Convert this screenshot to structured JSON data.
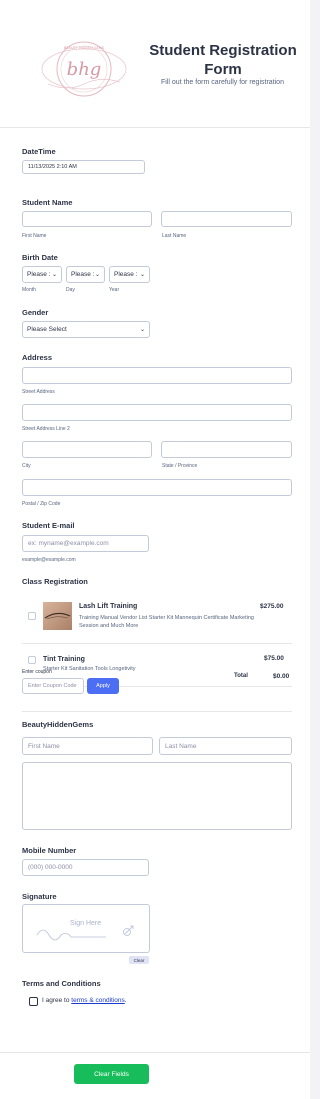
{
  "header": {
    "logo_text": "bhg",
    "logo_ring_text": "BEAUTY HIDDEN GEMS",
    "title": "Student Registration Form",
    "subtitle": "Fill out the form carefully for registration"
  },
  "datetime": {
    "label": "DateTime",
    "value": "11/13/2025 2:10 AM"
  },
  "student_name": {
    "label": "Student Name",
    "first_sub": "First Name",
    "last_sub": "Last Name"
  },
  "birth_date": {
    "label": "Birth Date",
    "month": "Please :",
    "day": "Please :",
    "year": "Please :",
    "month_sub": "Month",
    "day_sub": "Day",
    "year_sub": "Year"
  },
  "gender": {
    "label": "Gender",
    "value": "Please Select"
  },
  "address": {
    "label": "Address",
    "street_sub": "Street Address",
    "street2_sub": "Street Address Line 2",
    "city_sub": "City",
    "state_sub": "State / Province",
    "postal_sub": "Postal / Zip Code"
  },
  "email": {
    "label": "Student E-mail",
    "placeholder": "ex: myname@example.com",
    "sub": "example@example.com"
  },
  "class_registration": {
    "label": "Class Registration",
    "products": [
      {
        "title": "Lash Lift Training",
        "desc": "Training Manual Vendor List Starter Kit Mannequin Certificate Marketing Session and Much More",
        "price": "$275.00"
      },
      {
        "title": "Tint Training",
        "desc": "Starter Kit Sanitation Tools Longetivity",
        "price": "$75.00"
      }
    ],
    "coupon_label": "Enter coupon",
    "coupon_placeholder": "Enter Coupon Code",
    "apply": "Apply",
    "total_label": "Total",
    "total_value": "$0.00"
  },
  "bhg_section": {
    "label": "BeautyHiddenGems",
    "first_placeholder": "First Name",
    "last_placeholder": "Last Name"
  },
  "mobile": {
    "label": "Mobile Number",
    "placeholder": "(000) 000-0000"
  },
  "signature": {
    "label": "Signature",
    "hint": "Sign Here",
    "clear": "Clear"
  },
  "terms": {
    "label": "Terms and Conditions",
    "text": "I agree to ",
    "link": "terms & conditions",
    "end": "."
  },
  "footer": {
    "clear_fields": "Clear Fields"
  }
}
